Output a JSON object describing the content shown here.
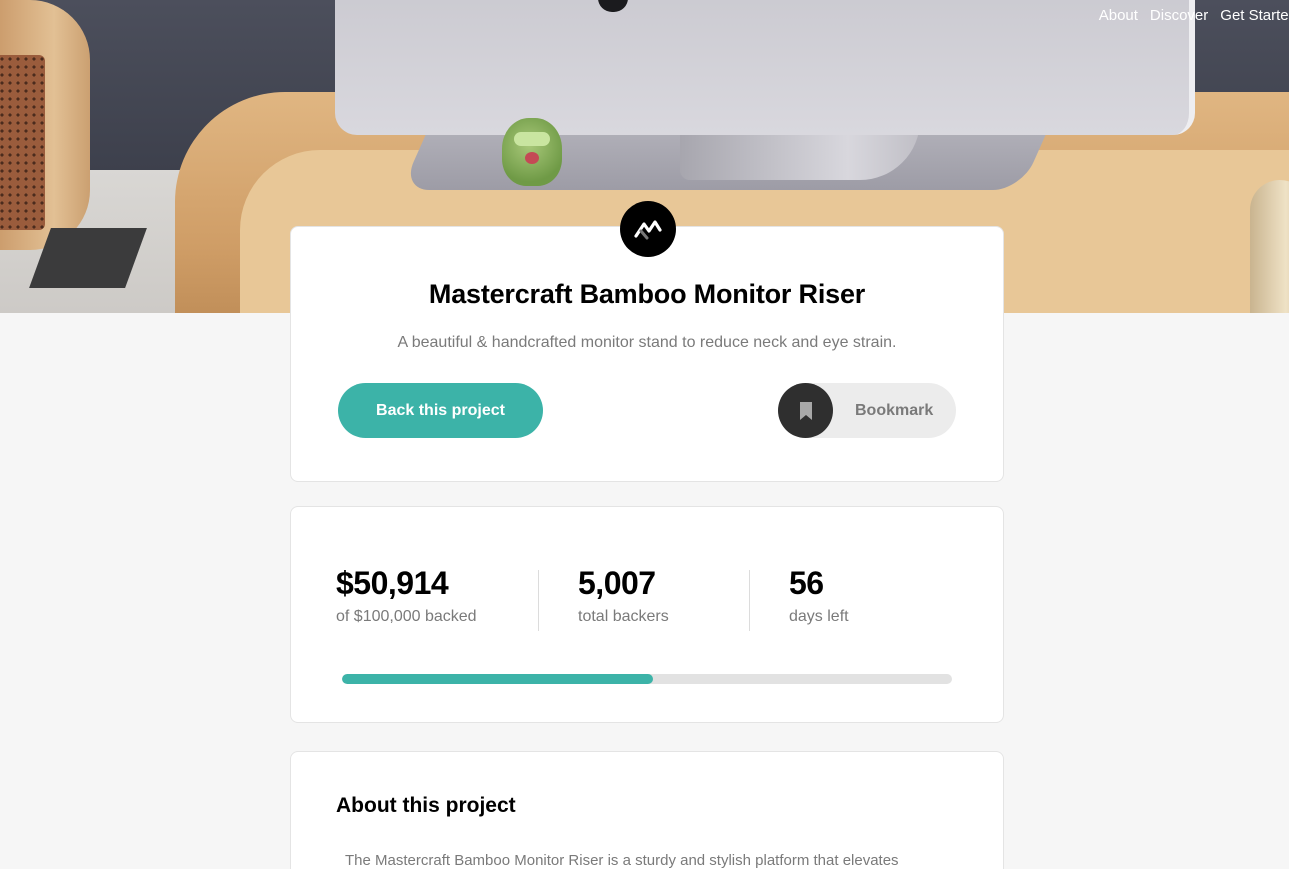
{
  "nav": {
    "items": [
      {
        "label": "About"
      },
      {
        "label": "Discover"
      },
      {
        "label": "Get Started"
      }
    ]
  },
  "project": {
    "title": "Mastercraft Bamboo Monitor Riser",
    "subtitle": "A beautiful & handcrafted monitor stand to reduce neck and eye strain.",
    "back_label": "Back this project",
    "bookmark_label": "Bookmark",
    "logo_icon": "mastercraft-logo-icon",
    "bookmark_icon": "bookmark-icon"
  },
  "stats": {
    "backed": {
      "value": "$50,914",
      "label": "of $100,000 backed"
    },
    "backers": {
      "value": "5,007",
      "label": "total backers"
    },
    "days": {
      "value": "56",
      "label": "days left"
    },
    "progress_percent": 51
  },
  "about": {
    "title": "About this project",
    "text": "The Mastercraft Bamboo Monitor Riser is a sturdy and stylish platform that elevates"
  },
  "colors": {
    "accent": "#3cb3a8",
    "dark": "#2f2f2f",
    "text_muted": "#7a7a7a",
    "background": "#f6f6f6"
  }
}
